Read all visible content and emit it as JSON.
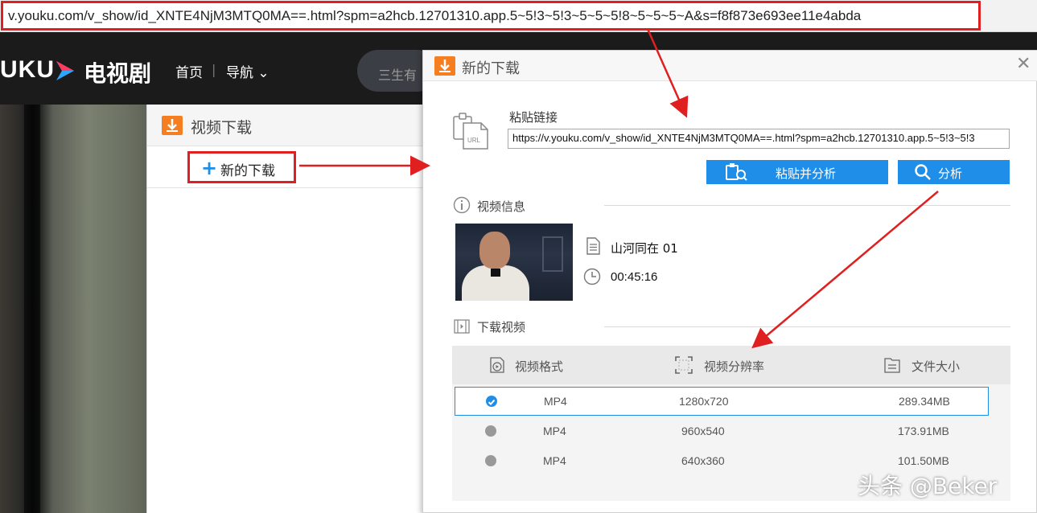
{
  "browser": {
    "url": "v.youku.com/v_show/id_XNTE4NjM3MTQ0MA==.html?spm=a2hcb.12701310.app.5~5!3~5!3~5~5~5!8~5~5~5~A&s=f8f873e693ee11e4abda"
  },
  "youku": {
    "logo": "UKU",
    "channel": "电视剧",
    "nav_home": "首页",
    "nav_sep": "|",
    "nav_menu": "导航",
    "search_hint": "三生有"
  },
  "download_panel": {
    "title": "视频下载",
    "new_download_label": "新的下载"
  },
  "dialog": {
    "title": "新的下载",
    "paste_label": "粘贴链接",
    "url_value": "https://v.youku.com/v_show/id_XNTE4NjM3MTQ0MA==.html?spm=a2hcb.12701310.app.5~5!3~5!3",
    "paste_analyze_label": "粘贴并分析",
    "analyze_label": "分析",
    "video_info_label": "视频信息",
    "video_title": "山河同在 01",
    "video_duration": "00:45:16",
    "download_video_label": "下载视频",
    "table": {
      "headers": [
        "视频格式",
        "视频分辨率",
        "文件大小"
      ],
      "rows": [
        {
          "format": "MP4",
          "resolution": "1280x720",
          "size": "289.34MB",
          "selected": true
        },
        {
          "format": "MP4",
          "resolution": "960x540",
          "size": "173.91MB",
          "selected": false
        },
        {
          "format": "MP4",
          "resolution": "640x360",
          "size": "101.50MB",
          "selected": false
        }
      ]
    }
  },
  "watermark": "头条 @Beker",
  "colors": {
    "accent_blue": "#1e8ee8",
    "annotation_red": "#e02020",
    "download_orange": "#f57f20"
  }
}
